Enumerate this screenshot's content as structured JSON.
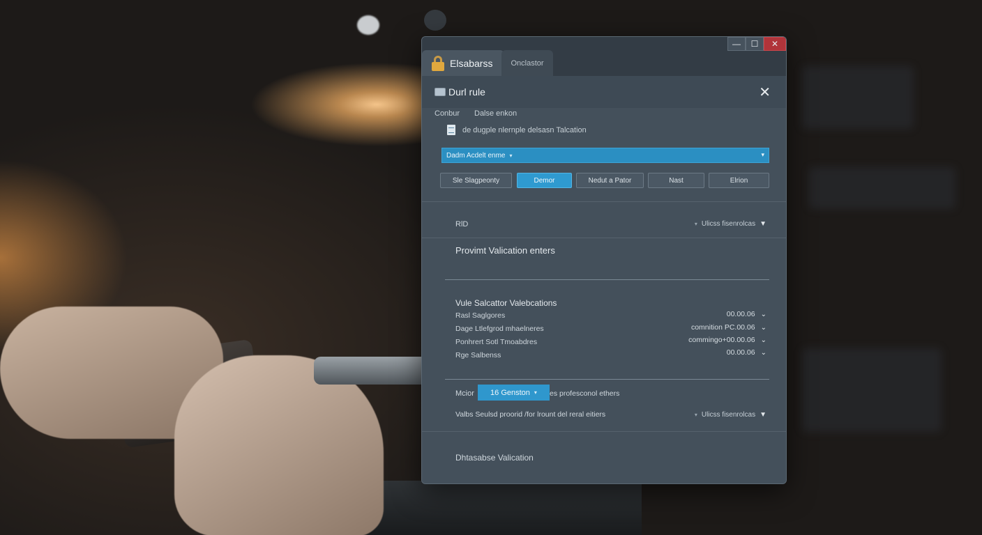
{
  "window": {
    "tab_active": "Elsabarss",
    "tab_inactive": "Onclastor",
    "controls": {
      "minimize": "—",
      "maximize": "☐",
      "close": "✕"
    }
  },
  "dialog": {
    "title": "Durl rule",
    "close": "✕",
    "sub_a": "Conbur",
    "sub_b": "Dalse enkon",
    "info": "de dugple nlernple delsasn Talcation",
    "select_value": "Dadm Acdelt enme",
    "buttons": [
      "Sle Slagpeonty",
      "Demor",
      "Nedut a Pator",
      "Nast",
      "Elrion"
    ]
  },
  "rows": {
    "rid_label": "RlD",
    "rid_right": "Ulicss fisenrolcas",
    "provimt": "Provimt Valication enters"
  },
  "validations": {
    "title": "Vule Salcattor Valebcations",
    "items": [
      {
        "label": "Rasl Saglgores",
        "value": "00.00.06"
      },
      {
        "label": "Dage Ltlefgrod mhaelneres",
        "value": "comnition PC.00.06"
      },
      {
        "label": "Ponhrert Sotl Tmoabdres",
        "value": "commingo+00.00.06"
      },
      {
        "label": "Rge Salbenss",
        "value": "00.00.06"
      }
    ]
  },
  "footer_rows": {
    "mode_prefix": "Mcior",
    "mode_badge": "16 Genston",
    "mode_suffix": "es profesconol ethers",
    "values_label": "Valbs Seulsd proorid /for lrount del reral eitiers",
    "values_right": "Ulicss fisenrolcas",
    "bottom": "Dhtasabse Valication"
  },
  "icons": {
    "lock": "lock-icon",
    "dialog": "monitor-icon",
    "doc": "document-icon",
    "dropdown": "chevron-down-icon"
  },
  "colors": {
    "accent": "#2f97cd",
    "window_bg": "#44505b",
    "close_red": "#b0343a",
    "lock_gold": "#e0a83e"
  }
}
